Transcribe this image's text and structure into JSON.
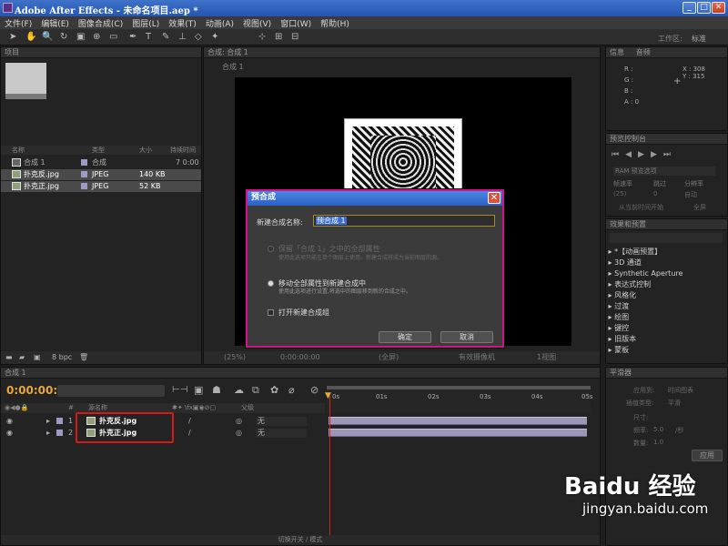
{
  "window": {
    "title": "Adobe After Effects - 未命名项目.aep *"
  },
  "menu": [
    "文件(F)",
    "编辑(E)",
    "图像合成(C)",
    "图层(L)",
    "效果(T)",
    "动画(A)",
    "视图(V)",
    "窗口(W)",
    "帮助(H)"
  ],
  "toolbar": {
    "workspace_label": "工作区:",
    "workspace_value": "标准"
  },
  "project": {
    "tab": "项目",
    "columns": {
      "name": "名称",
      "type": "类型",
      "size": "大小",
      "duration": "持续时间"
    },
    "items": [
      {
        "name": "合成 1",
        "type": "合成",
        "size": "",
        "duration": "7 0:00"
      },
      {
        "name": "扑克反.jpg",
        "type": "JPEG",
        "size": "140 KB",
        "duration": ""
      },
      {
        "name": "扑克正.jpg",
        "type": "JPEG",
        "size": "52 KB",
        "duration": ""
      }
    ],
    "bpc": "8 bpc"
  },
  "composition": {
    "tab": "合成: 合成 1",
    "breadcrumb": "合成 1",
    "zoom": "(25%)",
    "timecode": "0:00:00:00",
    "resolution": "(全屏)",
    "camera": "有效摄像机",
    "views": "1视图"
  },
  "dialog": {
    "title": "预合成",
    "name_label": "新建合成名称:",
    "name_value": "预合成 1",
    "option1_label": "保留「合成 1」之中的全部属性",
    "option1_desc": "使用此选项只能在单个图层上使用。新建合成将成为当前图层的源。",
    "option2_label": "移动全部属性到新建合成中",
    "option2_desc": "使用此选项进行设置,将选中的图层移到新的合成之中。",
    "open_label": "打开新建合成组",
    "ok": "确定",
    "cancel": "取消"
  },
  "info": {
    "tabs": [
      "信息",
      "音频"
    ],
    "r": "R :",
    "g": "G :",
    "b": "B :",
    "a": "A : 0",
    "x": "X : 308",
    "y": "Y : 315"
  },
  "preview": {
    "tab": "预览控制台",
    "ram": "RAM 预览选项",
    "fps_label": "帧速率",
    "skip_label": "跳过",
    "res_label": "分辨率",
    "fps": "(25)",
    "skip": "0",
    "res": "自动",
    "from_current": "从当前时间开始",
    "fullscreen": "全屏"
  },
  "effects": {
    "tab": "效果和预置",
    "items": [
      "*【动画预置】",
      "3D 通道",
      "Synthetic Aperture",
      "表达式控制",
      "风格化",
      "过渡",
      "绘图",
      "键控",
      "旧版本",
      "蒙板"
    ]
  },
  "timeline": {
    "tab": "合成 1",
    "timecode": "0:00:00:00",
    "col_source": "源名称",
    "col_parent": "父级",
    "layers": [
      {
        "num": "1",
        "name": "扑克反.jpg",
        "parent": "无"
      },
      {
        "num": "2",
        "name": "扑克正.jpg",
        "parent": "无"
      }
    ],
    "ruler": [
      "0s",
      "01s",
      "02s",
      "03s",
      "04s",
      "05s"
    ],
    "toggle": "切换开关 / 模式"
  },
  "smoother": {
    "tab": "平滑器",
    "apply_to_label": "应用到:",
    "apply_to": "时间图表",
    "type_label": "插值类型:",
    "type": "平滑",
    "size_label": "尺寸:",
    "freq_label": "频率:",
    "freq": "5.0",
    "freq_unit": "/秒",
    "amount_label": "数量:",
    "amount": "1.0",
    "apply": "应用"
  },
  "watermark": {
    "brand": "Baidu 经验",
    "url": "jingyan.baidu.com"
  }
}
